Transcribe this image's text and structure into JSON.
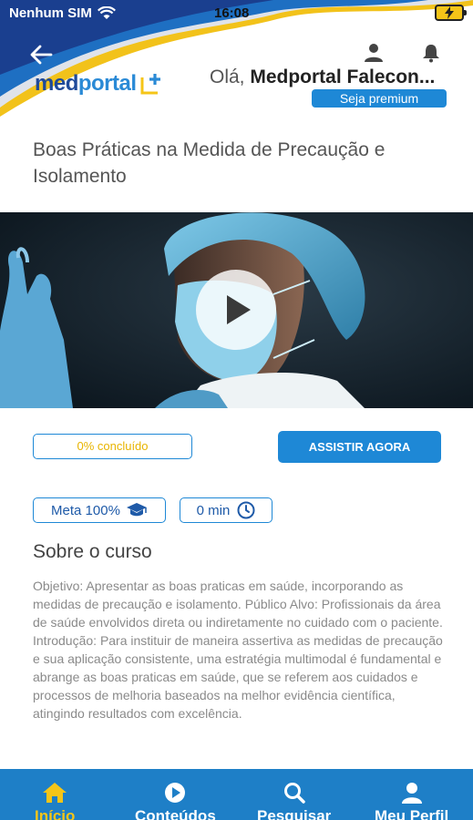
{
  "status_bar": {
    "carrier": "Nenhum SIM",
    "time": "16:08"
  },
  "header": {
    "logo_med": "med",
    "logo_portal": "portal",
    "greeting_prefix": "Olá, ",
    "user_name": "Medportal Falecon...",
    "premium_label": "Seja premium"
  },
  "course": {
    "title": "Boas Práticas na Medida de Precaução e Isolamento",
    "progress_label": "0% concluído",
    "progress": 0,
    "watch_label": "ASSISTIR AGORA",
    "goal_label": "Meta 100%",
    "duration_label": "0 min",
    "about_title": "Sobre o curso",
    "description": " Objetivo: Apresentar as boas praticas em saúde, incorporando as medidas de precaução e isolamento. Público Alvo: Profissionais da área de saúde envolvidos direta ou indiretamente no cuidado com o paciente. Introdução:    Para instituir de maneira assertiva as medidas de precaução e sua aplicação consistente, uma estratégia multimodal é fundamental e abrange as boas praticas em saúde, que se referem aos cuidados e processos de melhoria baseados na melhor evidência científica, atingindo resultados com excelência."
  },
  "nav": {
    "items": [
      {
        "label": "Início",
        "icon": "home-icon",
        "active": true
      },
      {
        "label": "Conteúdos",
        "icon": "play-circle-icon",
        "active": false
      },
      {
        "label": "Pesquisar",
        "icon": "search-icon",
        "active": false
      },
      {
        "label": "Meu Perfil",
        "icon": "user-icon",
        "active": false
      }
    ]
  },
  "colors": {
    "primary": "#1e88d6",
    "nav_bg": "#1e7fc7",
    "accent_yellow": "#f5c518",
    "brand_dark": "#1f4a9a"
  }
}
